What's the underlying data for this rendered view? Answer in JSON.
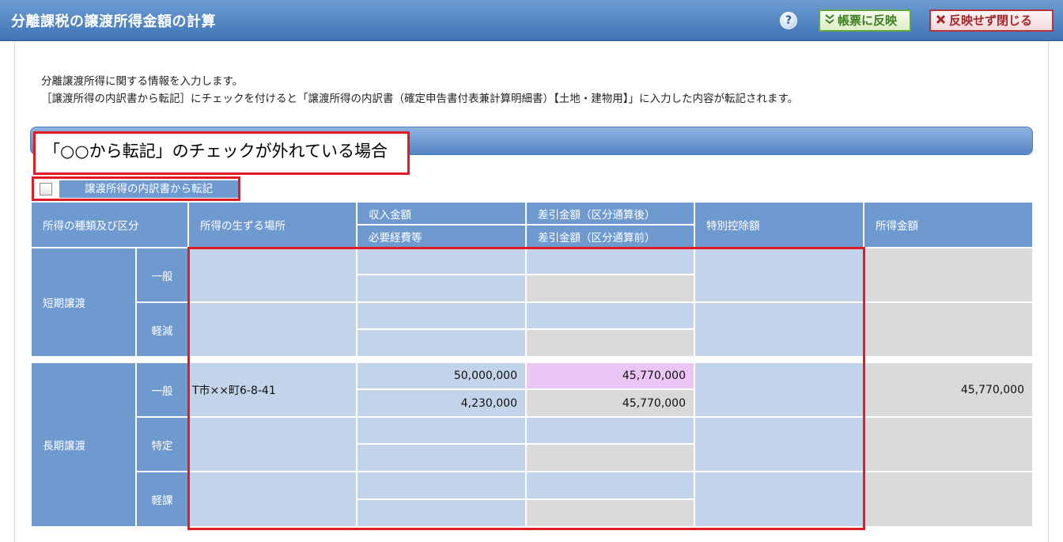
{
  "window": {
    "title": "分離課税の譲渡所得金額の計算",
    "help_label": "?",
    "reflect_label": "帳票に反映",
    "close_label": "反映せず閉じる"
  },
  "intro": {
    "line1": "分離譲渡所得に関する情報を入力します。",
    "line2": "［譲渡所得の内訳書から転記］にチェックを付けると「譲渡所得の内訳書（確定申告書付表兼計算明細書）【土地・建物用】」に入力した内容が転記されます。"
  },
  "callout": {
    "text": "「○○から転記」のチェックが外れている場合"
  },
  "transfer": {
    "label": "譲渡所得の内訳書から転記",
    "checked": false
  },
  "table": {
    "headers": {
      "kind": "所得の種類及び区分",
      "place": "所得の生ずる場所",
      "revenue": "収入金額",
      "expenses": "必要経費等",
      "diff_after": "差引金額（区分通算後）",
      "diff_before": "差引金額（区分通算前）",
      "special": "特別控除額",
      "income": "所得金額"
    },
    "groups": {
      "short": "短期譲渡",
      "long": "長期譲渡"
    },
    "subs": {
      "short_general": "一般",
      "short_reduced": "軽減",
      "long_general": "一般",
      "long_specific": "特定",
      "long_reduced": "軽課"
    },
    "long_general": {
      "place": "T市××町6-8-41",
      "revenue": "50,000,000",
      "expenses": "4,230,000",
      "diff_after": "45,770,000",
      "diff_before": "45,770,000",
      "income": "45,770,000"
    }
  }
}
